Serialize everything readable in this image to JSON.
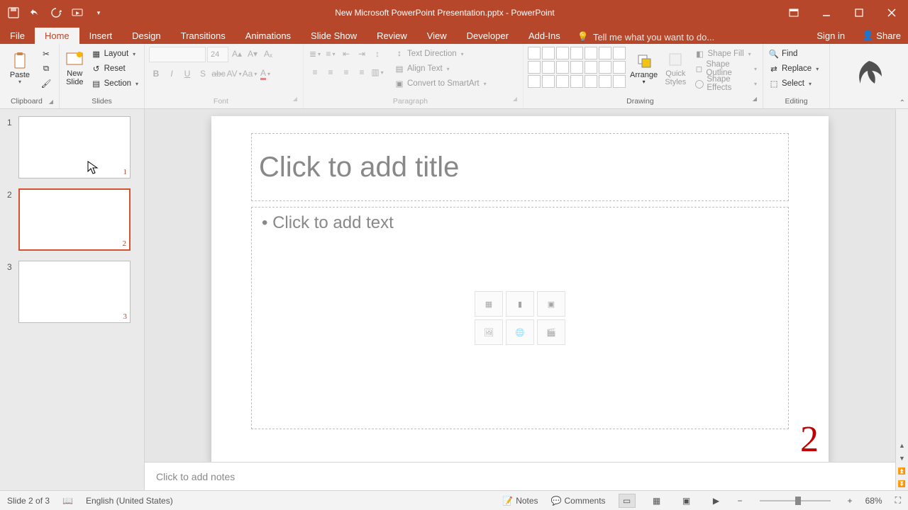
{
  "titlebar": {
    "title": "New Microsoft PowerPoint Presentation.pptx - PowerPoint"
  },
  "tabs": {
    "file": "File",
    "home": "Home",
    "insert": "Insert",
    "design": "Design",
    "transitions": "Transitions",
    "animations": "Animations",
    "slideshow": "Slide Show",
    "review": "Review",
    "view": "View",
    "developer": "Developer",
    "addins": "Add-Ins",
    "tellme": "Tell me what you want to do...",
    "signin": "Sign in",
    "share": "Share"
  },
  "ribbon": {
    "clipboard": {
      "label": "Clipboard",
      "paste": "Paste"
    },
    "slides": {
      "label": "Slides",
      "new_slide": "New\nSlide",
      "layout": "Layout",
      "reset": "Reset",
      "section": "Section"
    },
    "font": {
      "label": "Font",
      "size": "24"
    },
    "paragraph": {
      "label": "Paragraph",
      "text_direction": "Text Direction",
      "align_text": "Align Text",
      "convert_to_smartart": "Convert to SmartArt"
    },
    "drawing": {
      "label": "Drawing",
      "arrange": "Arrange",
      "quick_styles": "Quick\nStyles",
      "shape_fill": "Shape Fill",
      "shape_outline": "Shape Outline",
      "shape_effects": "Shape Effects"
    },
    "editing": {
      "label": "Editing",
      "find": "Find",
      "replace": "Replace",
      "select": "Select"
    }
  },
  "thumbs": [
    {
      "index": "1",
      "page_num": "1",
      "selected": false
    },
    {
      "index": "2",
      "page_num": "2",
      "selected": true
    },
    {
      "index": "3",
      "page_num": "3",
      "selected": false
    }
  ],
  "slide": {
    "title_placeholder": "Click to add title",
    "body_placeholder": "• Click to add text",
    "page_number": "2"
  },
  "notes": {
    "placeholder": "Click to add notes"
  },
  "status": {
    "slide_indicator": "Slide 2 of 3",
    "language": "English (United States)",
    "notes": "Notes",
    "comments": "Comments",
    "zoom": "68%"
  }
}
